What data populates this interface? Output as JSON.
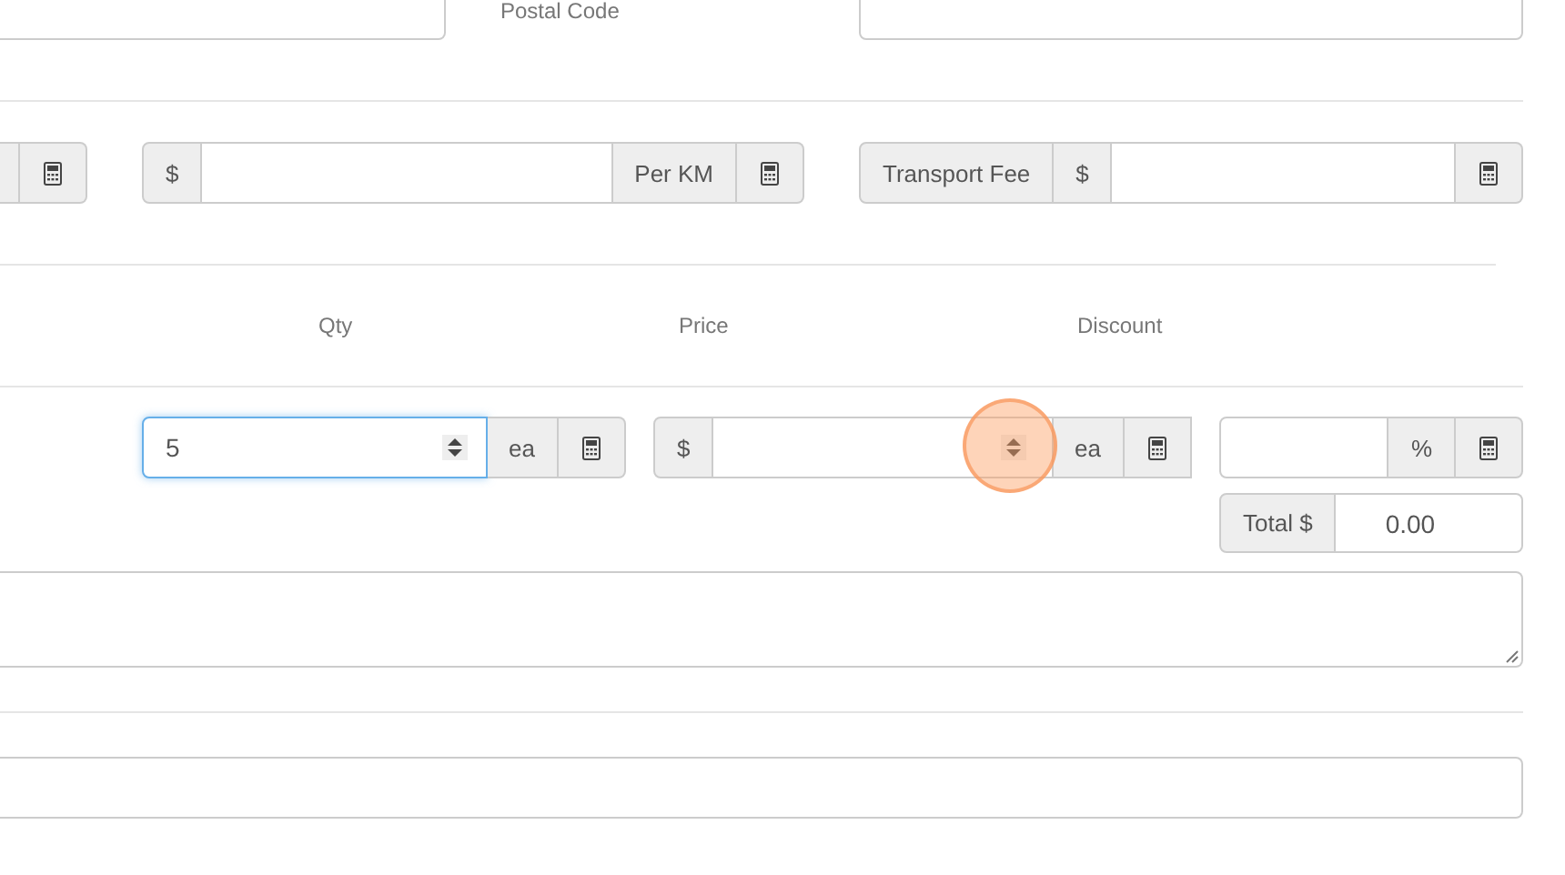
{
  "address": {
    "postal_code_label": "Postal Code"
  },
  "rates": {
    "per_km": {
      "prefix": "$",
      "suffix": "Per KM"
    },
    "transport_fee": {
      "label": "Transport Fee",
      "prefix": "$"
    }
  },
  "line_item": {
    "columns": [
      "Qty",
      "Price",
      "Discount"
    ],
    "qty": {
      "value": "5",
      "unit": "ea",
      "focused": true
    },
    "price": {
      "prefix": "$",
      "unit": "ea",
      "focused": false
    },
    "discount": {
      "suffix": "%"
    },
    "total": {
      "label": "Total $",
      "value": "0.00"
    }
  }
}
